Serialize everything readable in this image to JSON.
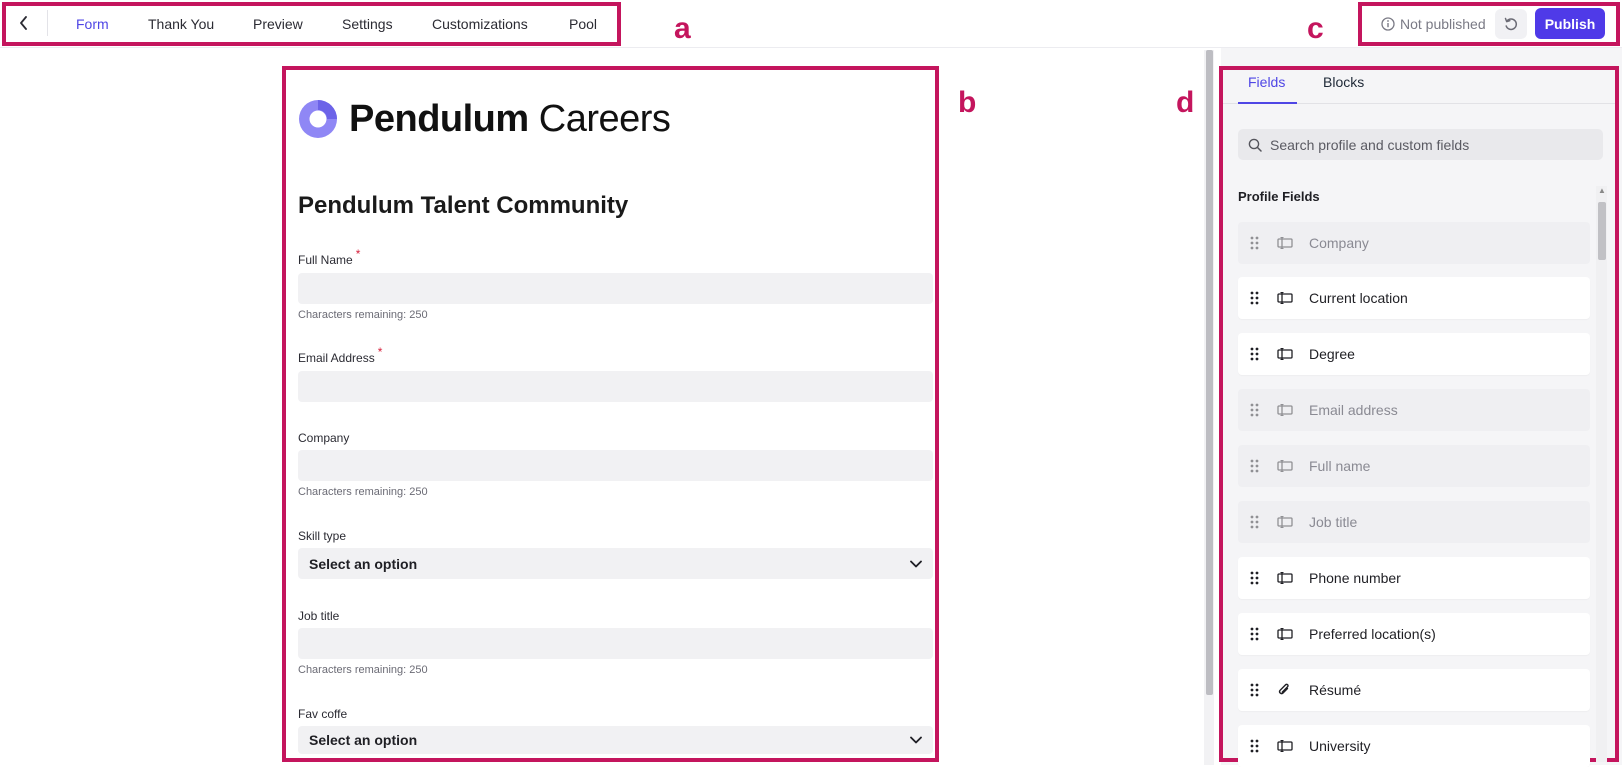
{
  "annotations": {
    "a": "a",
    "b": "b",
    "c": "c",
    "d": "d"
  },
  "nav": {
    "tabs": [
      {
        "label": "Form",
        "active": true
      },
      {
        "label": "Thank You",
        "active": false
      },
      {
        "label": "Preview",
        "active": false
      },
      {
        "label": "Settings",
        "active": false
      },
      {
        "label": "Customizations",
        "active": false
      },
      {
        "label": "Pool",
        "active": false
      }
    ]
  },
  "header_actions": {
    "status": "Not published",
    "publish_label": "Publish"
  },
  "form": {
    "brand_bold": "Pendulum",
    "brand_light": "Careers",
    "title": "Pendulum Talent Community",
    "required_mark": "*",
    "fields": [
      {
        "label": "Full Name",
        "required": true,
        "type": "text",
        "hint": "Characters remaining: 250"
      },
      {
        "label": "Email Address",
        "required": true,
        "type": "text",
        "hint": ""
      },
      {
        "label": "Company",
        "required": false,
        "type": "text",
        "hint": "Characters remaining: 250"
      },
      {
        "label": "Skill type",
        "required": false,
        "type": "select",
        "value": "Select an option"
      },
      {
        "label": "Job title",
        "required": false,
        "type": "text",
        "hint": "Characters remaining: 250"
      },
      {
        "label": "Fav coffe",
        "required": false,
        "type": "select",
        "value": "Select an option"
      }
    ]
  },
  "panel": {
    "tabs": [
      {
        "label": "Fields",
        "active": true
      },
      {
        "label": "Blocks",
        "active": false
      }
    ],
    "search_placeholder": "Search profile and custom fields",
    "section_title": "Profile Fields",
    "fields": [
      {
        "name": "Company",
        "icon": "text-field-icon",
        "disabled": true
      },
      {
        "name": "Current location",
        "icon": "text-field-icon",
        "disabled": false
      },
      {
        "name": "Degree",
        "icon": "text-field-icon",
        "disabled": false
      },
      {
        "name": "Email address",
        "icon": "text-field-icon",
        "disabled": true
      },
      {
        "name": "Full name",
        "icon": "text-field-icon",
        "disabled": true
      },
      {
        "name": "Job title",
        "icon": "text-field-icon",
        "disabled": true
      },
      {
        "name": "Phone number",
        "icon": "text-field-icon",
        "disabled": false
      },
      {
        "name": "Preferred location(s)",
        "icon": "text-field-icon",
        "disabled": false
      },
      {
        "name": "Résumé",
        "icon": "paperclip-icon",
        "disabled": false
      },
      {
        "name": "University",
        "icon": "text-field-icon",
        "disabled": false
      }
    ]
  },
  "colors": {
    "accent": "#4f46e5",
    "publish": "#4f3ae8",
    "annotation": "#c4155d",
    "required": "#d61f3b"
  }
}
